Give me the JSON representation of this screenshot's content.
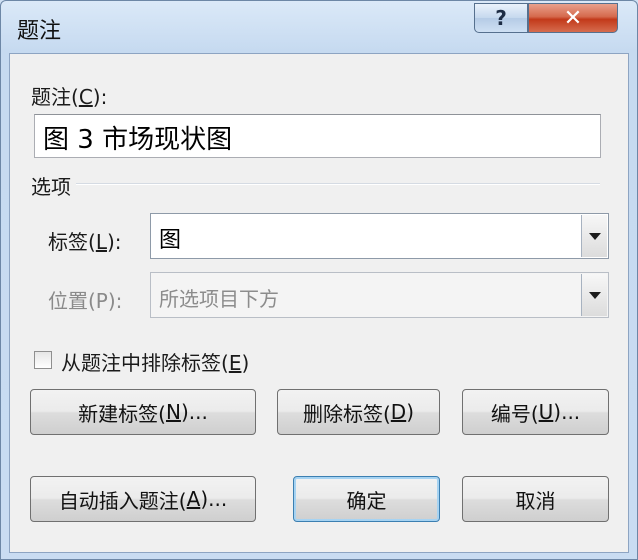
{
  "window": {
    "title": "题注"
  },
  "titlebar": {
    "help_glyph": "?",
    "close_glyph": "✕"
  },
  "caption": {
    "label_prefix": "题注(",
    "label_key": "C",
    "label_suffix": "):",
    "value": "图 3 市场现状图"
  },
  "options": {
    "group_label": "选项",
    "label_field": {
      "label_prefix": "标签(",
      "label_key": "L",
      "label_suffix": "):",
      "value": "图"
    },
    "position_field": {
      "label": "位置(P):",
      "value": "所选项目下方"
    }
  },
  "exclude_label": {
    "checked": false,
    "text_prefix": "从题注中排除标签(",
    "text_key": "E",
    "text_suffix": ")"
  },
  "buttons": {
    "new_label": {
      "prefix": "新建标签(",
      "key": "N",
      "suffix": ")..."
    },
    "delete_label": {
      "prefix": "删除标签(",
      "key": "D",
      "suffix": ")"
    },
    "numbering": {
      "prefix": "编号(",
      "key": "U",
      "suffix": ")..."
    },
    "auto_caption": {
      "prefix": "自动插入题注(",
      "key": "A",
      "suffix": ")..."
    },
    "ok": "确定",
    "cancel": "取消"
  }
}
